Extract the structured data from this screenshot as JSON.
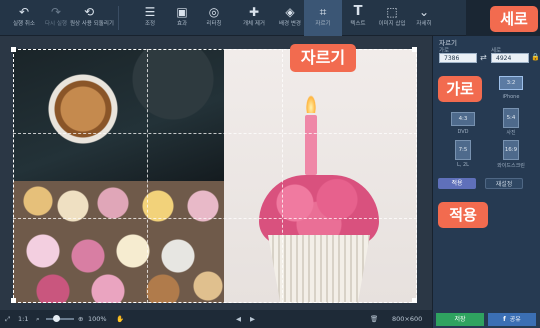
{
  "toolbar": {
    "items": [
      {
        "label": "실행 취소",
        "icon": "undo-icon",
        "glyph": "↶",
        "enabled": true
      },
      {
        "label": "다시 실행",
        "icon": "redo-icon",
        "glyph": "↷",
        "enabled": false
      },
      {
        "label": "원상 사용 되돌리기",
        "icon": "revert-icon",
        "glyph": "⟲",
        "enabled": true
      },
      {
        "label": "조정",
        "icon": "adjust-sliders-icon",
        "glyph": "☰",
        "enabled": true
      },
      {
        "label": "효과",
        "icon": "effects-icon",
        "glyph": "▣",
        "enabled": true
      },
      {
        "label": "리터칭",
        "icon": "retouch-icon",
        "glyph": "◎",
        "enabled": true
      },
      {
        "label": "개체 제거",
        "icon": "object-remove-icon",
        "glyph": "✚",
        "enabled": true
      },
      {
        "label": "배경 변경",
        "icon": "background-change-icon",
        "glyph": "◈",
        "enabled": true
      },
      {
        "label": "자르기",
        "icon": "crop-icon",
        "glyph": "⌗",
        "enabled": true,
        "active": true
      },
      {
        "label": "텍스트",
        "icon": "text-icon",
        "glyph": "T",
        "enabled": true
      },
      {
        "label": "이미지 삽입",
        "icon": "insert-image-icon",
        "glyph": "⬚",
        "enabled": true
      },
      {
        "label": "자세히",
        "icon": "more-chevron-icon",
        "glyph": "⌄",
        "enabled": true
      }
    ]
  },
  "bottom": {
    "fit_label": "1:1",
    "zoom": "100%",
    "image_size": "800×600"
  },
  "panel": {
    "title": "자르기",
    "width_label": "가로",
    "height_label": "세로",
    "width_value": "7386",
    "height_value": "4924",
    "ratios": [
      {
        "label": "3:2",
        "caption": "iPhone",
        "selected": true
      },
      {
        "label": "4:3",
        "caption": "DVD"
      },
      {
        "label": "5:4",
        "caption": "사진"
      },
      {
        "label": "7:5",
        "caption": "L, 2L"
      },
      {
        "label": "16:9",
        "caption": "와이드스크린"
      }
    ],
    "apply_label": "적용",
    "reset_label": "재설정"
  },
  "actions": {
    "save_label": "저장",
    "share_label": "공유"
  },
  "callouts": {
    "crop": "자르기",
    "height": "세로",
    "width": "가로",
    "apply": "적용"
  },
  "colors": {
    "callout": "#f26b4f",
    "toolbar": "#243547",
    "panel": "#263a52",
    "save": "#2fa360",
    "share": "#3b6fb4"
  }
}
